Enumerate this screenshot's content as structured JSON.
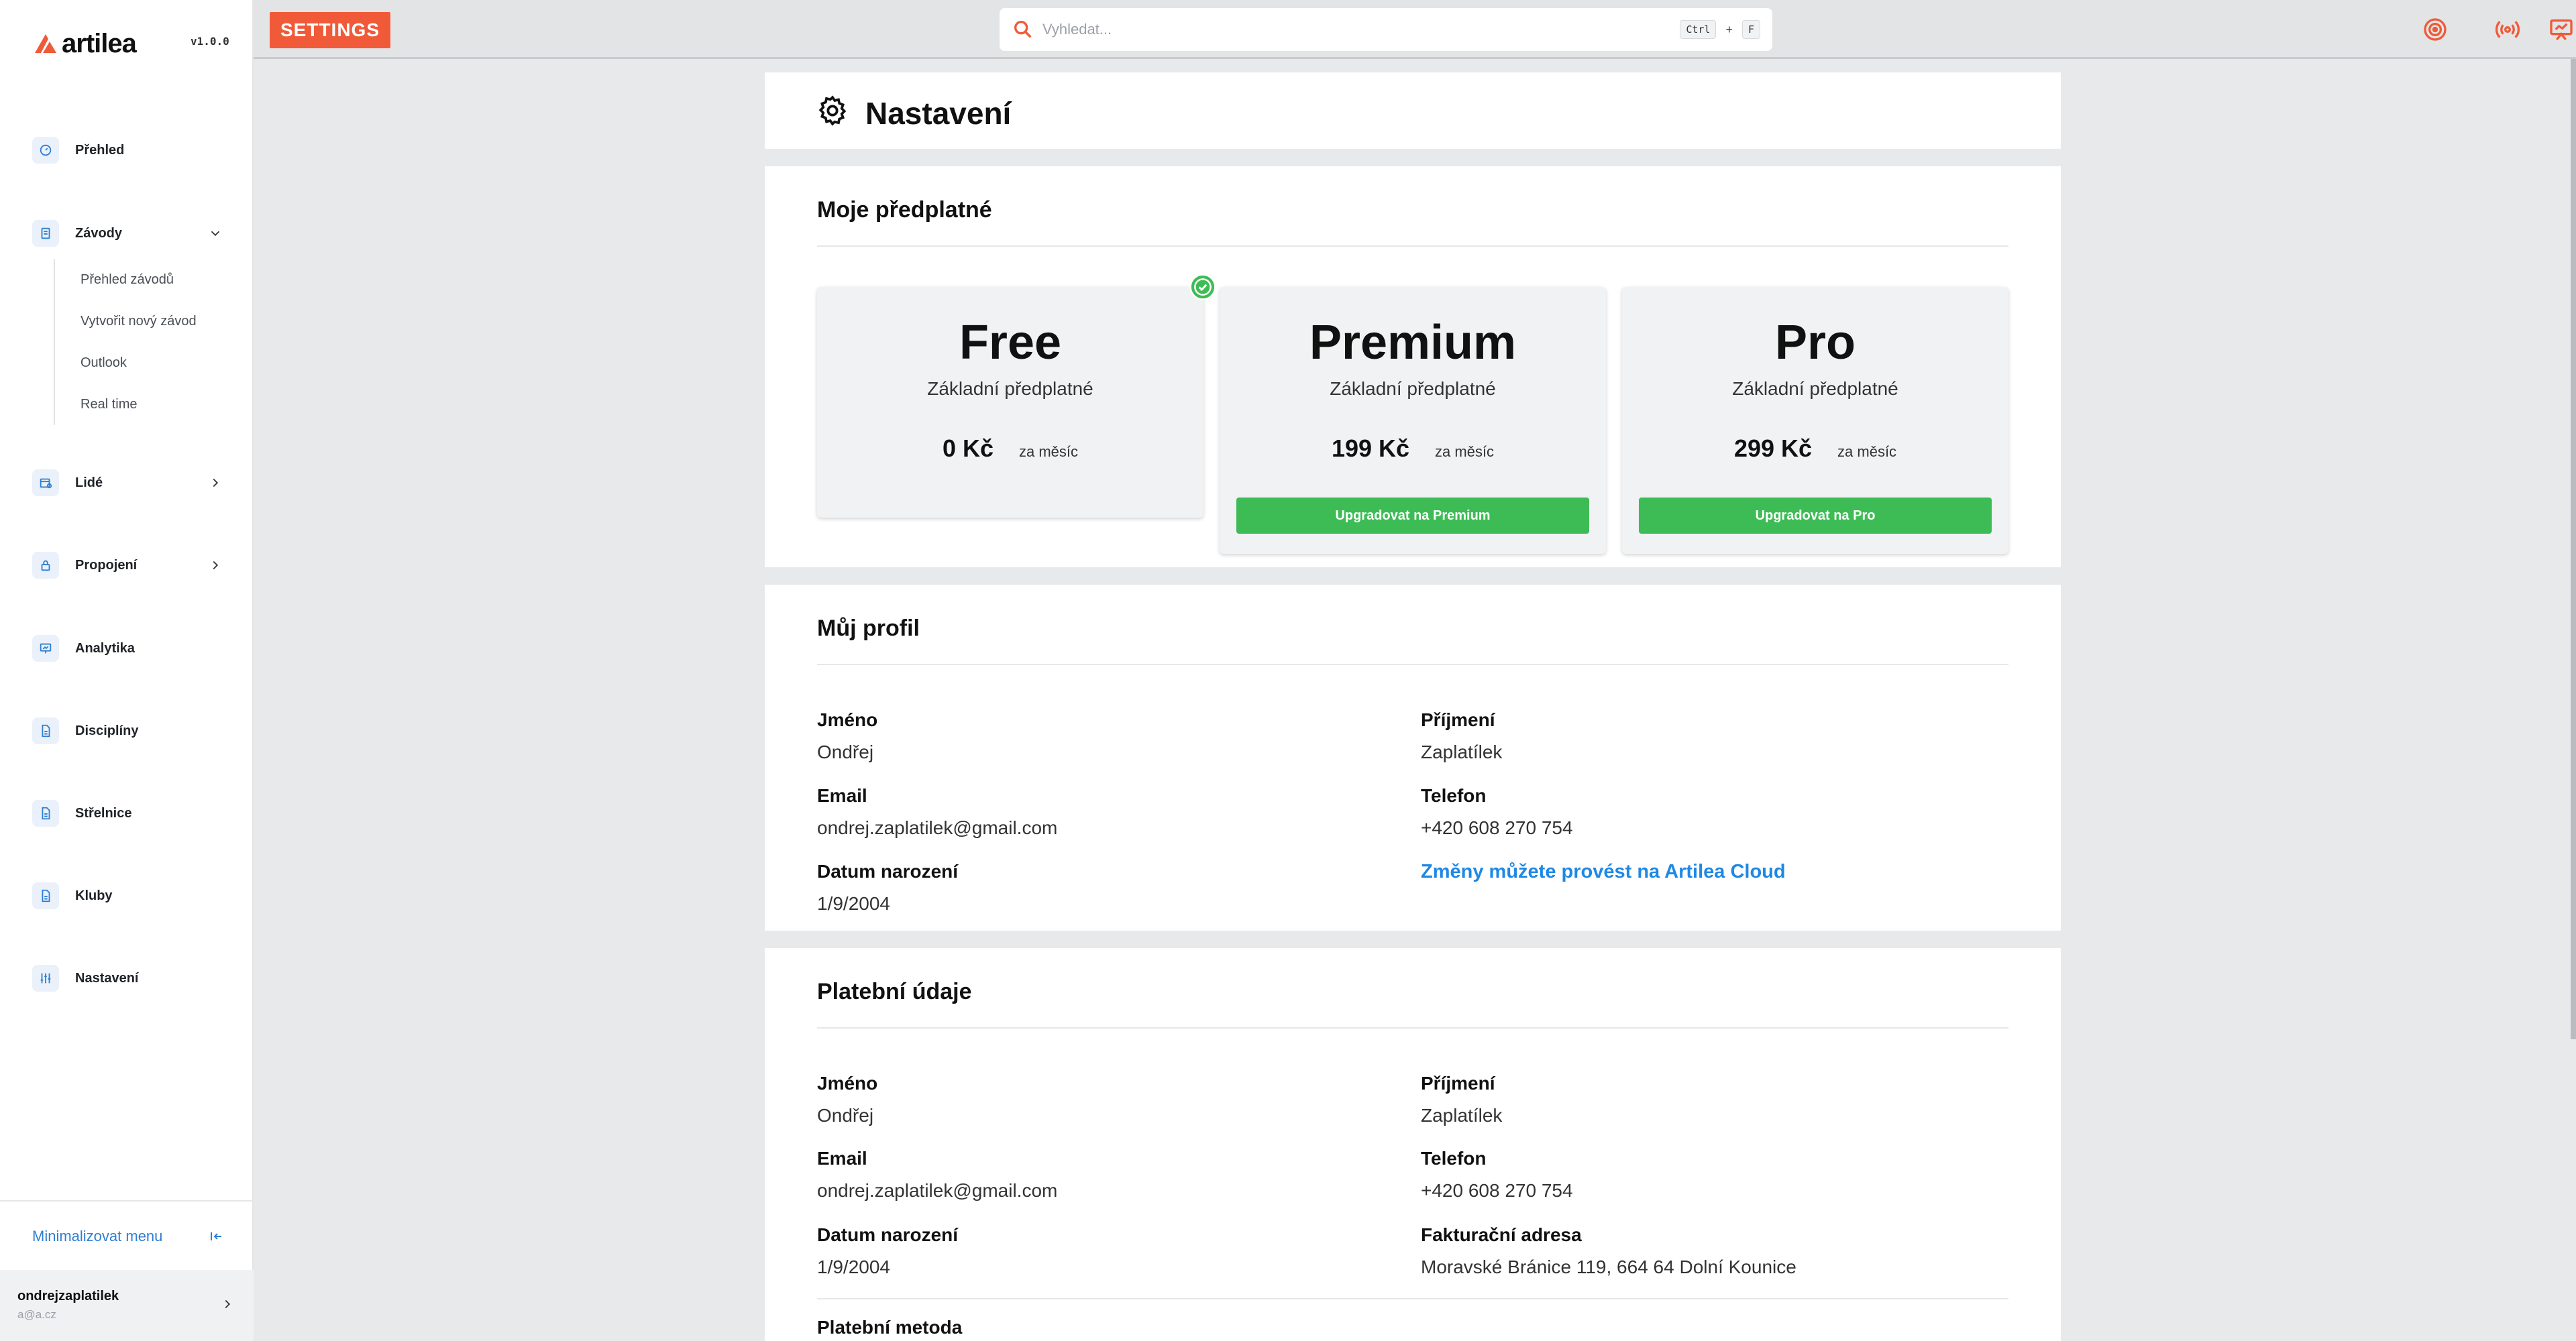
{
  "brand": {
    "name": "artilea",
    "version": "v1.0.0"
  },
  "sidebar": {
    "items": [
      {
        "label": "Přehled"
      },
      {
        "label": "Závody"
      },
      {
        "label": "Lidé"
      },
      {
        "label": "Propojení"
      },
      {
        "label": "Analytika"
      },
      {
        "label": "Disciplíny"
      },
      {
        "label": "Střelnice"
      },
      {
        "label": "Kluby"
      },
      {
        "label": "Nastavení"
      }
    ],
    "subitems": [
      {
        "label": "Přehled závodů"
      },
      {
        "label": "Vytvořit nový závod"
      },
      {
        "label": "Outlook"
      },
      {
        "label": "Real time"
      }
    ],
    "minimize_label": "Minimalizovat menu",
    "user": {
      "name": "ondrejzaplatilek",
      "email": "a@a.cz"
    }
  },
  "topbar": {
    "page_tag": "SETTINGS",
    "search_placeholder": "Vyhledat...",
    "shortcut_key1": "Ctrl",
    "shortcut_plus": "+",
    "shortcut_key2": "F"
  },
  "header": {
    "title": "Nastavení"
  },
  "subscription": {
    "title": "Moje předplatné",
    "plans": [
      {
        "name": "Free",
        "description": "Základní předplatné",
        "price": "0 Kč",
        "period": "za měsíc"
      },
      {
        "name": "Premium",
        "description": "Základní předplatné",
        "price": "199 Kč",
        "period": "za měsíc",
        "button": "Upgradovat na Premium"
      },
      {
        "name": "Pro",
        "description": "Základní předplatné",
        "price": "299 Kč",
        "period": "za měsíc",
        "button": "Upgradovat na Pro"
      }
    ]
  },
  "profile": {
    "title": "Můj profil",
    "first_name_label": "Jméno",
    "first_name": "Ondřej",
    "last_name_label": "Příjmení",
    "last_name": "Zaplatílek",
    "email_label": "Email",
    "email": "ondrej.zaplatilek@gmail.com",
    "phone_label": "Telefon",
    "phone": "+420 608 270 754",
    "birth_label": "Datum narození",
    "birth": "1/9/2004",
    "cloud_link": "Změny můžete provést na Artilea Cloud"
  },
  "billing": {
    "title": "Platební údaje",
    "first_name_label": "Jméno",
    "first_name": "Ondřej",
    "last_name_label": "Příjmení",
    "last_name": "Zaplatílek",
    "email_label": "Email",
    "email": "ondrej.zaplatilek@gmail.com",
    "phone_label": "Telefon",
    "phone": "+420 608 270 754",
    "birth_label": "Datum narození",
    "birth": "1/9/2004",
    "address_label": "Fakturační adresa",
    "address": "Moravské Bránice 119, 664 64 Dolní Kounice",
    "method_label": "Platební metoda"
  },
  "colors": {
    "accent": "#f05a38",
    "upgrade": "#3dbc55",
    "link": "#1e88e5",
    "nav_icon": "#2f7fd1"
  }
}
